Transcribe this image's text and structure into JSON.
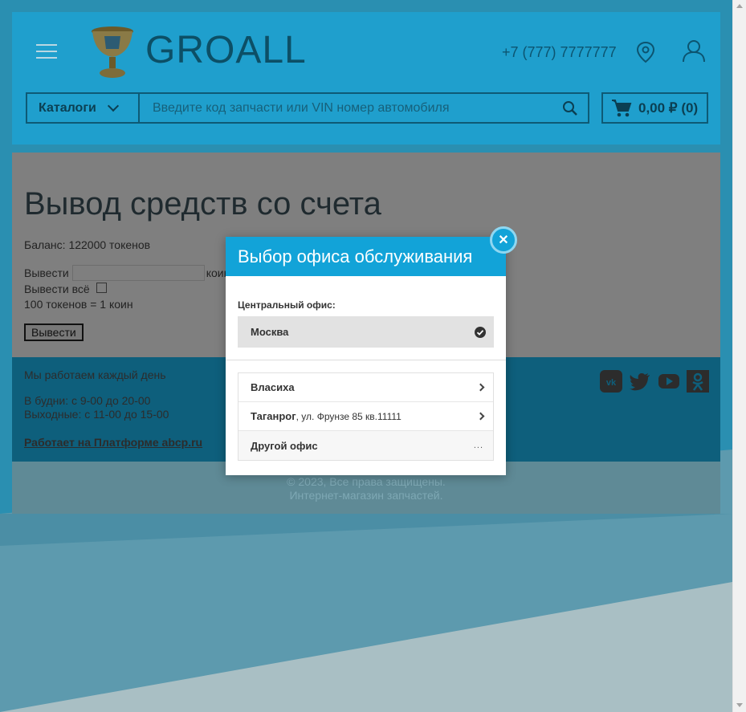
{
  "header": {
    "logo_text": "GROALL",
    "phone": "+7 (777) 7777777",
    "catalog_label": "Каталоги",
    "search_placeholder": "Введите код запчасти или VIN номер автомобиля",
    "cart_total": "0,00 ₽ (0)"
  },
  "content": {
    "title": "Вывод средств со счета",
    "balance": "Баланс: 122000 токенов",
    "withdraw_label": "Вывести",
    "withdraw_value": "",
    "withdraw_unit": "коин",
    "withdraw_all_label": "Вывести всё",
    "rate": "100 токенов = 1 коин",
    "withdraw_button": "Вывести"
  },
  "footer": {
    "schedule_title": "Мы работаем каждый день",
    "weekdays": "В будни: с 9-00 до 20-00",
    "weekends": "Выходные: с 11-00 до 15-00",
    "platform_link": "Работает на Платформе abcp.ru",
    "copyright": "© 2023, Все права защищены.",
    "shop": "Интернет-магазин запчастей.",
    "socials": [
      "vk-icon",
      "twitter-icon",
      "youtube-icon",
      "odnoklassniki-icon"
    ]
  },
  "modal": {
    "title": "Выбор офиса обслуживания",
    "central_label": "Центральный офис:",
    "central_office": "Москва",
    "offices": [
      {
        "name": "Власиха",
        "address": ""
      },
      {
        "name": "Таганрог",
        "address": ", ул. Фрунзе 85 кв.11111"
      },
      {
        "name": "Другой офис",
        "address": ""
      }
    ],
    "other_dots": "..."
  },
  "colors": {
    "header_bg": "#1f9fcd",
    "modal_accent": "#12a3d8"
  }
}
